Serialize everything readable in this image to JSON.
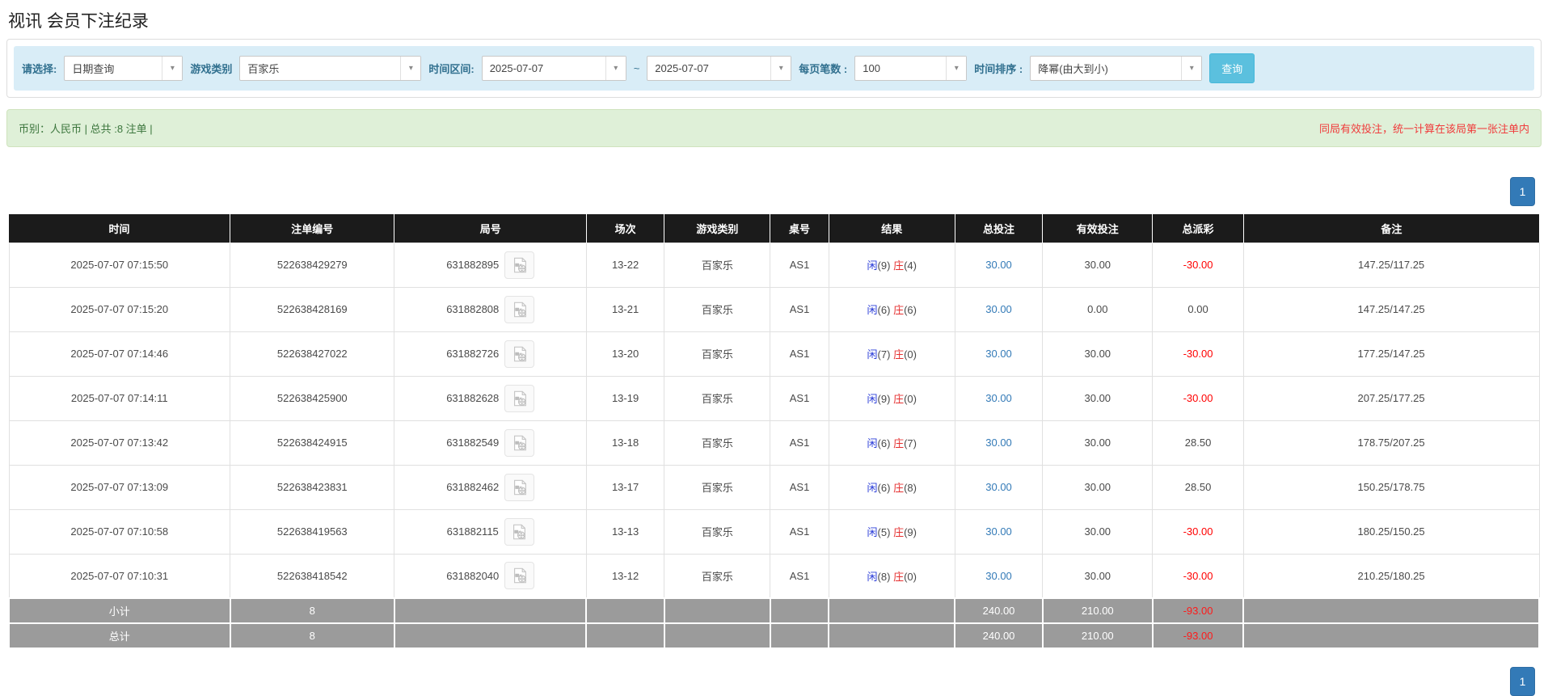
{
  "page": {
    "title": "视讯 会员下注纪录"
  },
  "colors": {
    "accent_blue": "#5bc0de",
    "pagination_blue": "#337ab7",
    "link_blue": "#337ab7",
    "player_blue": "#2a3cd8",
    "banker_red": "#e53030",
    "negative_red": "#ff0000",
    "filter_bar_bg": "#d9edf7",
    "notice_bar_bg": "#dff0d8",
    "notice_text_green": "#3c763d",
    "notice_text_red": "#f03c3c",
    "table_header_bg": "#1b1b1b",
    "summary_row_bg": "#9b9b9b"
  },
  "filters": {
    "select_label": "请选择:",
    "select_value": "日期查询",
    "game_type_label": "游戏类别",
    "game_type_value": "百家乐",
    "time_range_label": "时间区间:",
    "date_from": "2025-07-07",
    "tilde": "~",
    "date_to": "2025-07-07",
    "page_size_label": "每页笔数 :",
    "page_size_value": "100",
    "sort_label": "时间排序 :",
    "sort_value": "降幂(由大到小)",
    "search_button": "查询",
    "dropdown_icon": "▾"
  },
  "notice": {
    "left_text": "币别：人民币 | 总共 :8 注单 |",
    "right_text": "同局有效投注，统一计算在该局第一张注单内"
  },
  "pagination": {
    "page": "1"
  },
  "table": {
    "columns": [
      "时间",
      "注单编号",
      "局号",
      "场次",
      "游戏类别",
      "桌号",
      "结果",
      "总投注",
      "有效投注",
      "总派彩",
      "备注"
    ],
    "video_icon_name": "video-replay-icon",
    "rows": [
      {
        "time": "2025-07-07 07:15:50",
        "bet_id": "522638429279",
        "round_id": "631882895",
        "session": "13-22",
        "game": "百家乐",
        "table_no": "AS1",
        "player_label": "闲",
        "player_score": "(9)",
        "banker_label": "庄",
        "banker_score": "(4)",
        "total_bet": "30.00",
        "valid_bet": "30.00",
        "payout": "-30.00",
        "remark": "147.25/117.25"
      },
      {
        "time": "2025-07-07 07:15:20",
        "bet_id": "522638428169",
        "round_id": "631882808",
        "session": "13-21",
        "game": "百家乐",
        "table_no": "AS1",
        "player_label": "闲",
        "player_score": "(6)",
        "banker_label": "庄",
        "banker_score": "(6)",
        "total_bet": "30.00",
        "valid_bet": "0.00",
        "payout": "0.00",
        "remark": "147.25/147.25"
      },
      {
        "time": "2025-07-07 07:14:46",
        "bet_id": "522638427022",
        "round_id": "631882726",
        "session": "13-20",
        "game": "百家乐",
        "table_no": "AS1",
        "player_label": "闲",
        "player_score": "(7)",
        "banker_label": "庄",
        "banker_score": "(0)",
        "total_bet": "30.00",
        "valid_bet": "30.00",
        "payout": "-30.00",
        "remark": "177.25/147.25"
      },
      {
        "time": "2025-07-07 07:14:11",
        "bet_id": "522638425900",
        "round_id": "631882628",
        "session": "13-19",
        "game": "百家乐",
        "table_no": "AS1",
        "player_label": "闲",
        "player_score": "(9)",
        "banker_label": "庄",
        "banker_score": "(0)",
        "total_bet": "30.00",
        "valid_bet": "30.00",
        "payout": "-30.00",
        "remark": "207.25/177.25"
      },
      {
        "time": "2025-07-07 07:13:42",
        "bet_id": "522638424915",
        "round_id": "631882549",
        "session": "13-18",
        "game": "百家乐",
        "table_no": "AS1",
        "player_label": "闲",
        "player_score": "(6)",
        "banker_label": "庄",
        "banker_score": "(7)",
        "total_bet": "30.00",
        "valid_bet": "30.00",
        "payout": "28.50",
        "remark": "178.75/207.25"
      },
      {
        "time": "2025-07-07 07:13:09",
        "bet_id": "522638423831",
        "round_id": "631882462",
        "session": "13-17",
        "game": "百家乐",
        "table_no": "AS1",
        "player_label": "闲",
        "player_score": "(6)",
        "banker_label": "庄",
        "banker_score": "(8)",
        "total_bet": "30.00",
        "valid_bet": "30.00",
        "payout": "28.50",
        "remark": "150.25/178.75"
      },
      {
        "time": "2025-07-07 07:10:58",
        "bet_id": "522638419563",
        "round_id": "631882115",
        "session": "13-13",
        "game": "百家乐",
        "table_no": "AS1",
        "player_label": "闲",
        "player_score": "(5)",
        "banker_label": "庄",
        "banker_score": "(9)",
        "total_bet": "30.00",
        "valid_bet": "30.00",
        "payout": "-30.00",
        "remark": "180.25/150.25"
      },
      {
        "time": "2025-07-07 07:10:31",
        "bet_id": "522638418542",
        "round_id": "631882040",
        "session": "13-12",
        "game": "百家乐",
        "table_no": "AS1",
        "player_label": "闲",
        "player_score": "(8)",
        "banker_label": "庄",
        "banker_score": "(0)",
        "total_bet": "30.00",
        "valid_bet": "30.00",
        "payout": "-30.00",
        "remark": "210.25/180.25"
      }
    ],
    "subtotal": {
      "label": "小计",
      "count": "8",
      "total_bet": "240.00",
      "valid_bet": "210.00",
      "payout": "-93.00"
    },
    "total": {
      "label": "总计",
      "count": "8",
      "total_bet": "240.00",
      "valid_bet": "210.00",
      "payout": "-93.00"
    }
  }
}
